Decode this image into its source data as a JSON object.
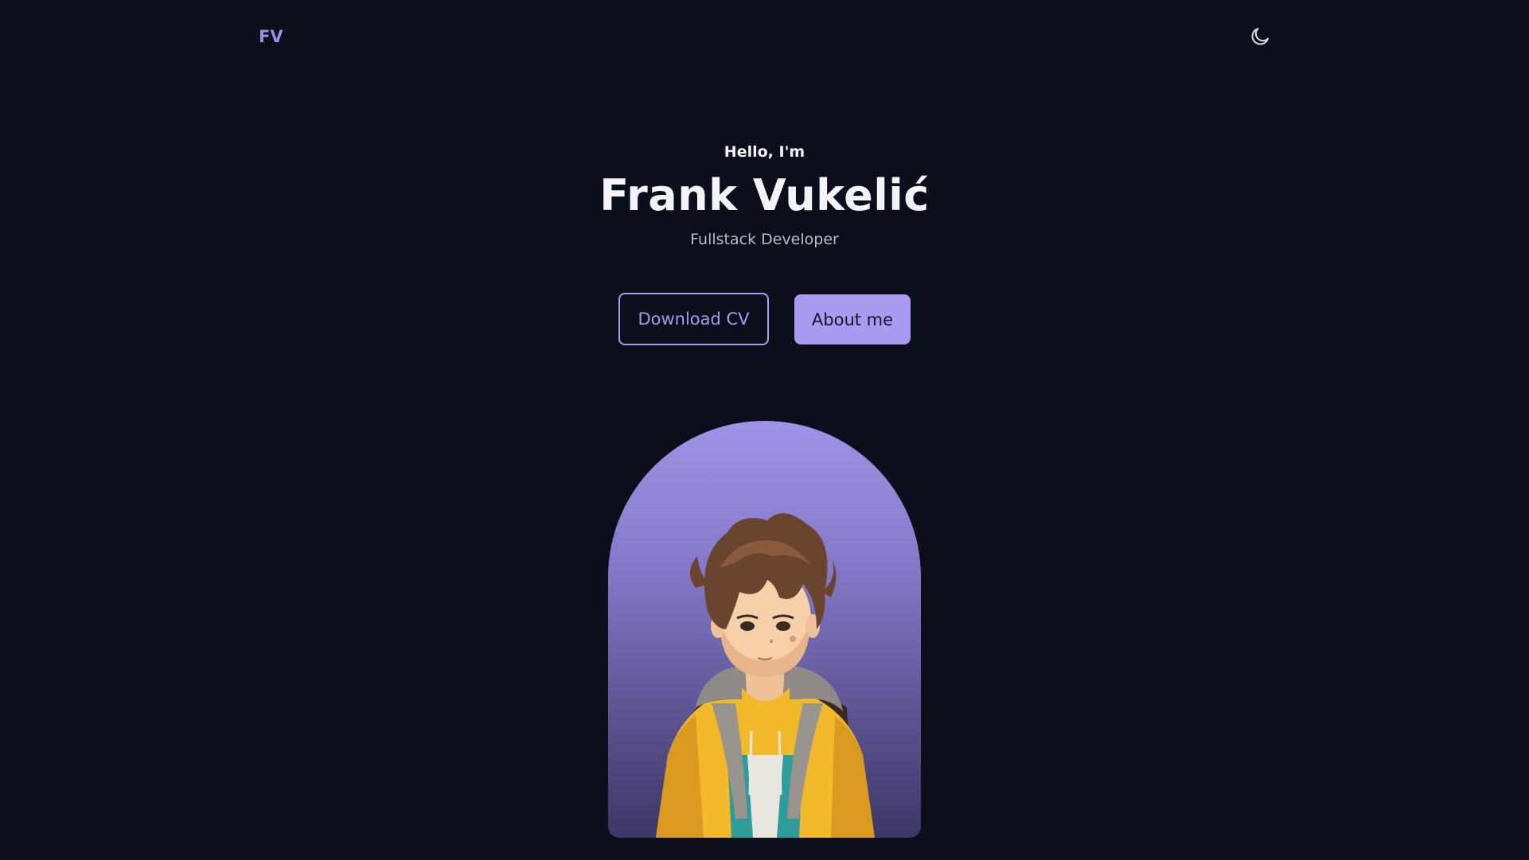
{
  "header": {
    "logo_text": "FV",
    "theme_toggle_icon": "moon-icon"
  },
  "hero": {
    "greeting": "Hello, I'm",
    "name": "Frank Vukelić",
    "role": "Fullstack Developer",
    "download_cv_label": "Download CV",
    "about_me_label": "About me",
    "portrait_alt": "avatar-illustration"
  },
  "colors": {
    "background": "#0b0f1c",
    "accent": "#a99bf1",
    "text": "#f4f4f8",
    "muted_text": "#b8bbc7"
  }
}
